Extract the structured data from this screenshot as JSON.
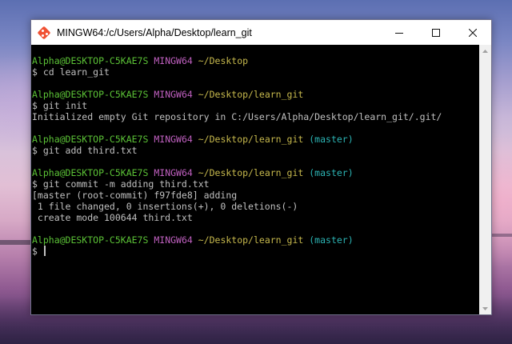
{
  "window": {
    "title": "MINGW64:/c/Users/Alpha/Desktop/learn_git",
    "icon": "git-diamond-icon",
    "controls": {
      "minimize": "minimize-icon",
      "maximize": "maximize-icon",
      "close": "close-icon"
    }
  },
  "colors": {
    "user_host": "#5bc236",
    "shell": "#c060c0",
    "path": "#c7b94d",
    "branch": "#2cb5b5",
    "text": "#c0c0c0",
    "background": "#000000"
  },
  "terminal": {
    "blocks": [
      {
        "prompt": {
          "user_host": "Alpha@DESKTOP-C5KAE7S",
          "shell": "MINGW64",
          "path": "~/Desktop",
          "branch": ""
        },
        "command": "$ cd learn_git",
        "output": []
      },
      {
        "prompt": {
          "user_host": "Alpha@DESKTOP-C5KAE7S",
          "shell": "MINGW64",
          "path": "~/Desktop/learn_git",
          "branch": ""
        },
        "command": "$ git init",
        "output": [
          "Initialized empty Git repository in C:/Users/Alpha/Desktop/learn_git/.git/"
        ]
      },
      {
        "prompt": {
          "user_host": "Alpha@DESKTOP-C5KAE7S",
          "shell": "MINGW64",
          "path": "~/Desktop/learn_git",
          "branch": "(master)"
        },
        "command": "$ git add third.txt",
        "output": []
      },
      {
        "prompt": {
          "user_host": "Alpha@DESKTOP-C5KAE7S",
          "shell": "MINGW64",
          "path": "~/Desktop/learn_git",
          "branch": "(master)"
        },
        "command": "$ git commit -m adding third.txt",
        "output": [
          "[master (root-commit) f97fde8] adding",
          " 1 file changed, 0 insertions(+), 0 deletions(-)",
          " create mode 100644 third.txt"
        ]
      },
      {
        "prompt": {
          "user_host": "Alpha@DESKTOP-C5KAE7S",
          "shell": "MINGW64",
          "path": "~/Desktop/learn_git",
          "branch": "(master)"
        },
        "command": "$ ",
        "output": [],
        "cursor": true
      }
    ]
  }
}
